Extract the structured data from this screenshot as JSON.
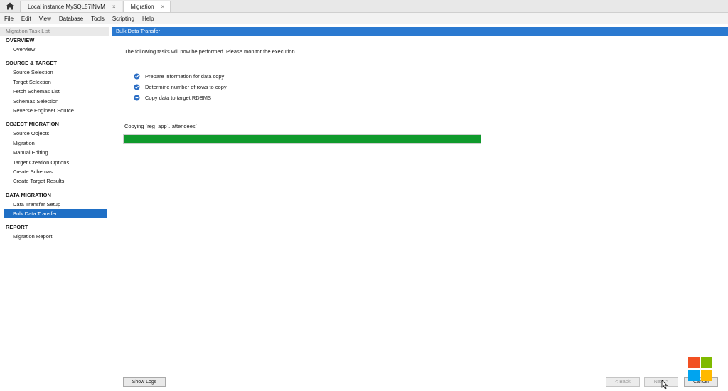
{
  "tabs": [
    {
      "label": "Local instance MySQL57INVM",
      "close": "×"
    },
    {
      "label": "Migration",
      "close": "×"
    }
  ],
  "menu": [
    "File",
    "Edit",
    "View",
    "Database",
    "Tools",
    "Scripting",
    "Help"
  ],
  "sidebar": {
    "header": "Migration Task List",
    "sections": [
      {
        "title": "OVERVIEW",
        "items": [
          "Overview"
        ]
      },
      {
        "title": "SOURCE & TARGET",
        "items": [
          "Source Selection",
          "Target Selection",
          "Fetch Schemas List",
          "Schemas Selection",
          "Reverse Engineer Source"
        ]
      },
      {
        "title": "OBJECT MIGRATION",
        "items": [
          "Source Objects",
          "Migration",
          "Manual Editing",
          "Target Creation Options",
          "Create Schemas",
          "Create Target Results"
        ]
      },
      {
        "title": "DATA MIGRATION",
        "items": [
          "Data Transfer Setup",
          "Bulk Data Transfer"
        ]
      },
      {
        "title": "REPORT",
        "items": [
          "Migration Report"
        ]
      }
    ]
  },
  "main": {
    "header": "Bulk Data Transfer",
    "intro": "The following tasks will now be performed. Please monitor the execution.",
    "tasks": [
      {
        "label": "Prepare information for data copy",
        "status": "done"
      },
      {
        "label": "Determine number of rows to copy",
        "status": "done"
      },
      {
        "label": "Copy data to target RDBMS",
        "status": "running"
      }
    ],
    "copying": "Copying `reg_app`.`attendees`",
    "progress": 1.0
  },
  "buttons": {
    "show_logs": "Show Logs",
    "back": "< Back",
    "next": "Next >",
    "cancel": "Cancel"
  },
  "colors": {
    "accent": "#2a79d0",
    "selection": "#1f6fc5",
    "progress": "#0f9a2c"
  },
  "icons": {
    "home": "home-icon",
    "done": "check-circle-icon",
    "running": "running-circle-icon"
  }
}
